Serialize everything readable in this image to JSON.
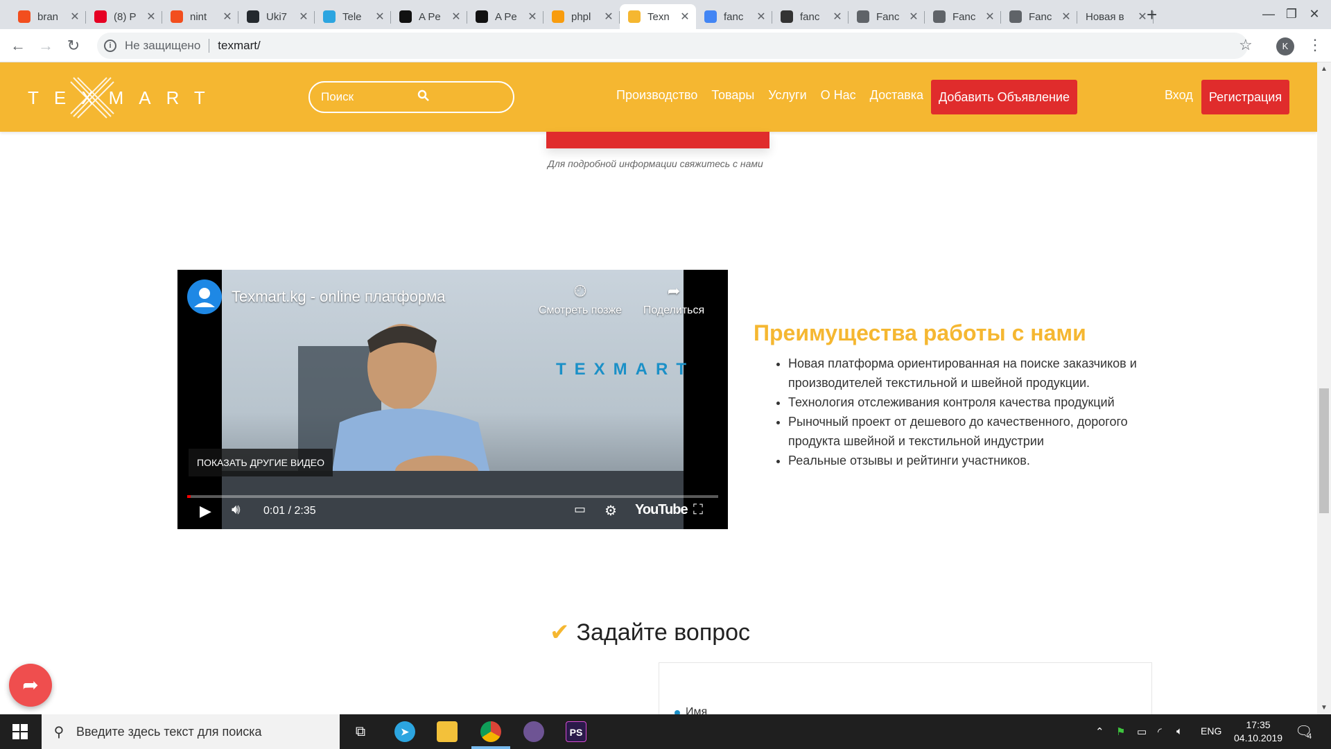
{
  "browser": {
    "tabs": [
      {
        "title": "bran",
        "icon": "figma-icon",
        "color": "#f24e1e"
      },
      {
        "title": "(8) P",
        "icon": "pinterest-icon",
        "color": "#e60023"
      },
      {
        "title": "nint",
        "icon": "figma-icon",
        "color": "#f24e1e"
      },
      {
        "title": "Uki7",
        "icon": "github-icon",
        "color": "#24292e"
      },
      {
        "title": "Tele",
        "icon": "telegram-icon",
        "color": "#2ca5e0"
      },
      {
        "title": "A Pe",
        "icon": "codepen-icon",
        "color": "#111111"
      },
      {
        "title": "A Pe",
        "icon": "codepen-icon",
        "color": "#111111"
      },
      {
        "title": "phpl",
        "icon": "phpmyadmin-icon",
        "color": "#f89c0e"
      },
      {
        "title": "Texn",
        "icon": "texmart-icon",
        "color": "#f5b731"
      },
      {
        "title": "fanc",
        "icon": "google-icon",
        "color": "#4285f4"
      },
      {
        "title": "fanc",
        "icon": "mountain-icon",
        "color": "#333333"
      },
      {
        "title": "Fanc",
        "icon": "globe-icon",
        "color": "#5f6368"
      },
      {
        "title": "Fanc",
        "icon": "globe-icon",
        "color": "#5f6368"
      },
      {
        "title": "Fanc",
        "icon": "globe-icon",
        "color": "#5f6368"
      },
      {
        "title": "Новая в",
        "icon": "",
        "color": "#5f6368"
      }
    ],
    "security_label": "Не защищено",
    "url": "texmart/",
    "profile_initial": "K"
  },
  "header": {
    "logo_text": "TEXMART",
    "search_placeholder": "Поиск",
    "nav": [
      "Производство",
      "Товары",
      "Услуги",
      "О Нас",
      "Доставка"
    ],
    "add_listing": "Добавить Объявление",
    "login": "Вход",
    "register": "Регистрация"
  },
  "main": {
    "contact_note": "Для подробной информации свяжитесь с нами",
    "video": {
      "title": "Texmart.kg - online платформа",
      "watch_later": "Смотреть позже",
      "share": "Поделиться",
      "brand_overlay": "TEXMART",
      "more_videos": "ПОКАЗАТЬ ДРУГИЕ ВИДЕО",
      "time": "0:01 / 2:35",
      "progress": 0.006,
      "platform": "YouTube"
    },
    "advantages_title": "Преимущества работы с нами",
    "advantages": [
      "Новая платформа ориентированная на поиске заказчиков и производителей текстильной и швейной продукции.",
      "Технология отслеживания контроля качества продукций",
      "Рыночный проект от дешевого до качественного, дорогого продукта швейной и текстильной индустрии",
      "Реальные отзывы и рейтинги участников."
    ],
    "ask_title": "Задайте вопрос",
    "form_first_label": "Имя"
  },
  "colors": {
    "brand_yellow": "#f5b731",
    "brand_red": "#e02c2c",
    "fab_red": "#ef4e4e"
  },
  "taskbar": {
    "search_placeholder": "Введите здесь текст для поиска",
    "language": "ENG",
    "time": "17:35",
    "date": "04.10.2019",
    "notification_count": "4"
  }
}
